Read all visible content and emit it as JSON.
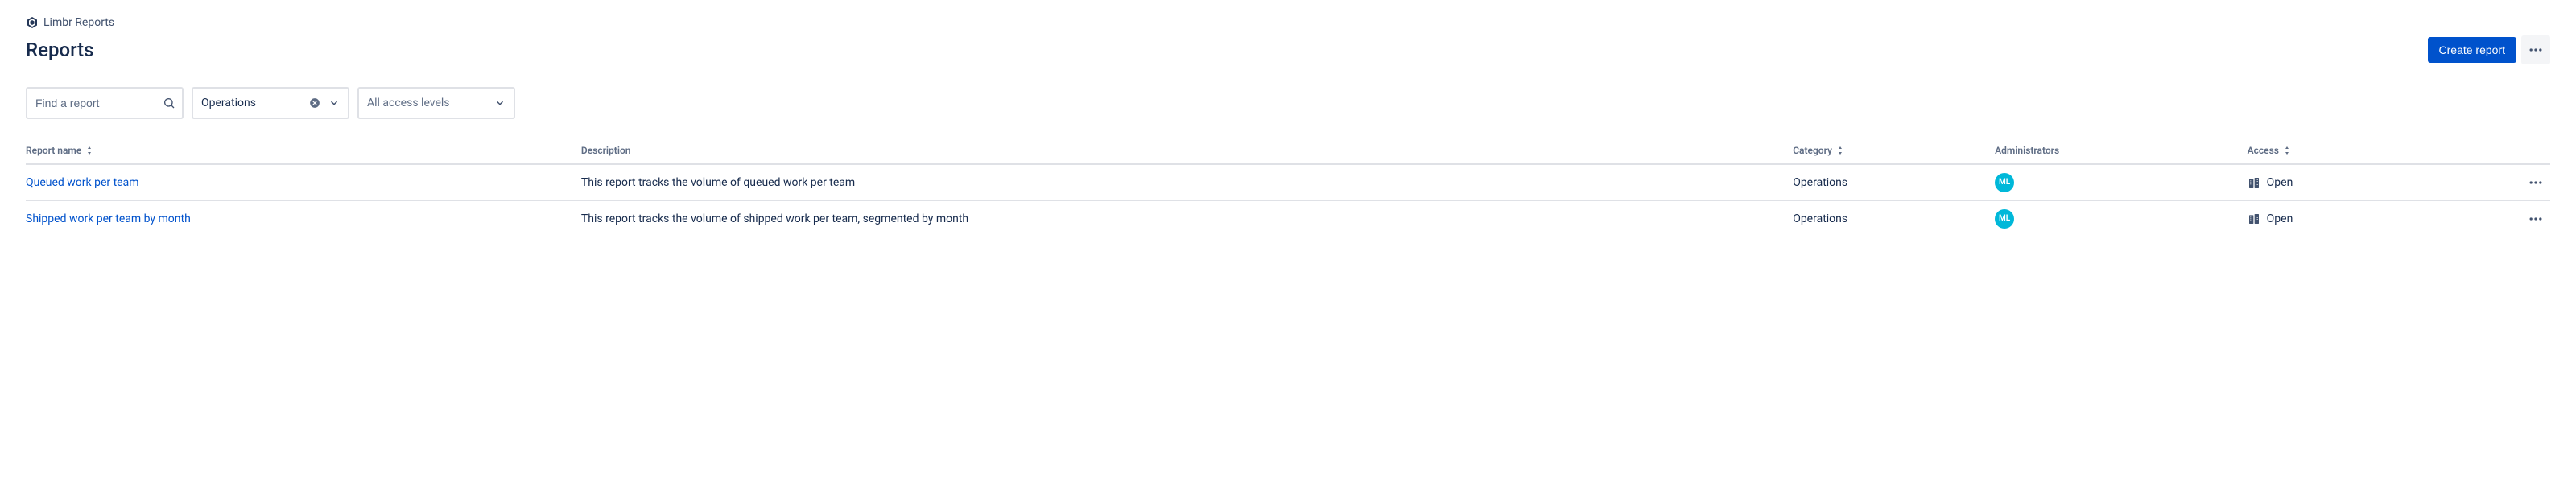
{
  "breadcrumb": {
    "app_name": "Limbr Reports"
  },
  "page": {
    "title": "Reports"
  },
  "actions": {
    "create_label": "Create report"
  },
  "filters": {
    "search_placeholder": "Find a report",
    "category_value": "Operations",
    "access_placeholder": "All access levels"
  },
  "table": {
    "headers": {
      "name": "Report name",
      "description": "Description",
      "category": "Category",
      "administrators": "Administrators",
      "access": "Access"
    },
    "rows": [
      {
        "name": "Queued work per team",
        "description": "This report tracks the volume of queued work per team",
        "category": "Operations",
        "admin_initials": "ML",
        "access": "Open"
      },
      {
        "name": "Shipped work per team by month",
        "description": "This report tracks the volume of shipped work per team, segmented by month",
        "category": "Operations",
        "admin_initials": "ML",
        "access": "Open"
      }
    ]
  }
}
